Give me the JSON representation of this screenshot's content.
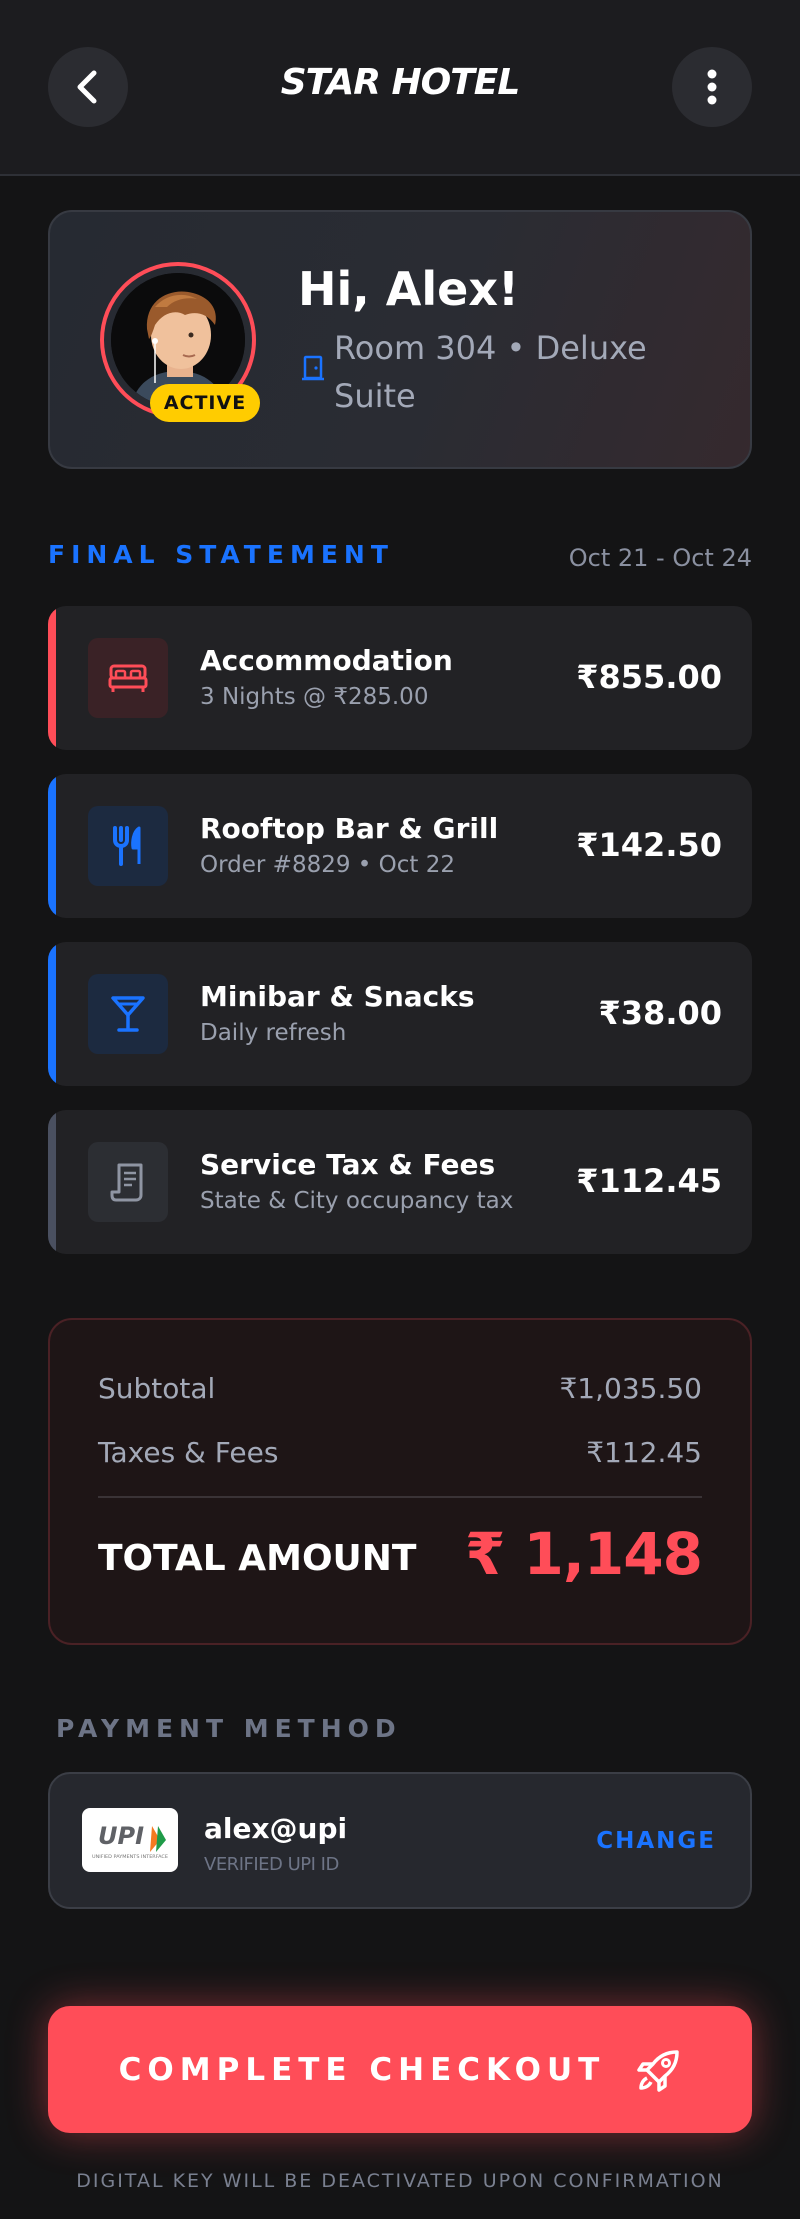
{
  "header": {
    "title": "STAR HOTEL",
    "back_icon": "chevron-left-icon",
    "menu_icon": "more-vertical-icon"
  },
  "guest": {
    "greeting": "Hi, Alex!",
    "room": "Room 304 • Deluxe Suite",
    "status_badge": "ACTIVE"
  },
  "statement": {
    "label": "FINAL STATEMENT",
    "date_range": "Oct 21 - Oct 24",
    "items": [
      {
        "name": "Accommodation",
        "detail": "3 Nights @ ₹285.00",
        "amount": "₹855.00",
        "icon": "bed-icon",
        "accent": "#ff4d58"
      },
      {
        "name": "Rooftop Bar & Grill",
        "detail": "Order #8829 • Oct 22",
        "amount": "₹142.50",
        "icon": "utensils-icon",
        "accent": "#1a73ff"
      },
      {
        "name": "Minibar & Snacks",
        "detail": "Daily refresh",
        "amount": "₹38.00",
        "icon": "cocktail-icon",
        "accent": "#1a73ff"
      },
      {
        "name": "Service Tax & Fees",
        "detail": "State & City occupancy tax",
        "amount": "₹112.45",
        "icon": "receipt-icon",
        "accent": "#4a5060"
      }
    ]
  },
  "totals": {
    "subtotal_label": "Subtotal",
    "subtotal_value": "₹1,035.50",
    "taxes_label": "Taxes & Fees",
    "taxes_value": "₹112.45",
    "total_label": "TOTAL AMOUNT",
    "total_value": "₹ 1,148"
  },
  "payment": {
    "label": "PAYMENT METHOD",
    "upi_id": "alex@upi",
    "verified_text": "VERIFIED UPI ID",
    "change_label": "CHANGE",
    "logo_text": "UPI",
    "logo_subtext": "UNIFIED PAYMENTS INTERFACE"
  },
  "checkout": {
    "button_label": "COMPLETE CHECKOUT",
    "button_icon": "rocket-icon",
    "footnote": "DIGITAL KEY WILL BE DEACTIVATED UPON CONFIRMATION"
  },
  "colors": {
    "accent_red": "#ff4d58",
    "accent_blue": "#1a73ff",
    "badge_yellow": "#ffcc00"
  }
}
